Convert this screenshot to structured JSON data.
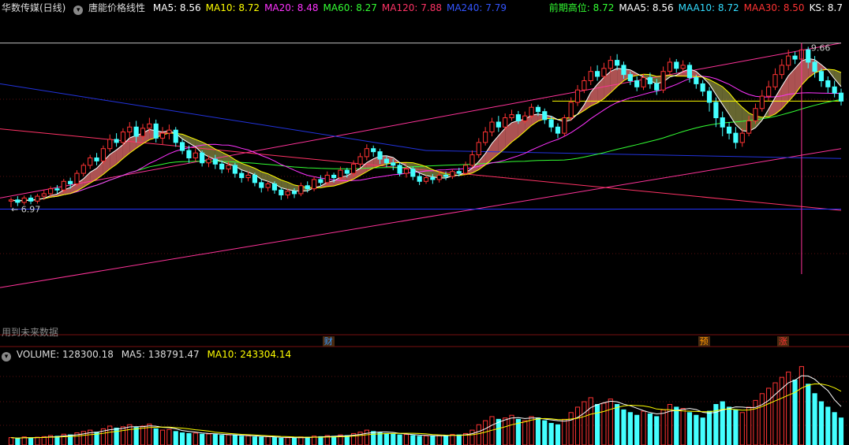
{
  "header": {
    "stock_name": "华数传媒(日线)",
    "indicator_name": "唐能价格线性",
    "ma": [
      {
        "label": "MA5:",
        "value": "8.56",
        "color": "#ffffff"
      },
      {
        "label": "MA10:",
        "value": "8.72",
        "color": "#ffff00"
      },
      {
        "label": "MA20:",
        "value": "8.48",
        "color": "#ff33ff"
      },
      {
        "label": "MA60:",
        "value": "8.27",
        "color": "#33ff33"
      },
      {
        "label": "MA120:",
        "value": "7.88",
        "color": "#ff3366"
      },
      {
        "label": "MA240:",
        "value": "7.79",
        "color": "#3355ff"
      }
    ],
    "right": [
      {
        "label": "前期高位:",
        "value": "8.72",
        "color": "#33ff33"
      },
      {
        "label": "MAA5:",
        "value": "8.56",
        "color": "#ffffff"
      },
      {
        "label": "MAA10:",
        "value": "8.72",
        "color": "#33ddff"
      },
      {
        "label": "MAA30:",
        "value": "8.50",
        "color": "#ff3333"
      },
      {
        "label": "KS:",
        "value": "8.7",
        "color": "#ffffff"
      }
    ]
  },
  "volume_header": {
    "volume_label": "VOLUME:",
    "volume_value": "128300.18",
    "ma5_label": "MA5:",
    "ma5_value": "138791.47",
    "ma10_label": "MA10:",
    "ma10_value": "243304.14"
  },
  "notes": {
    "future_data": "用到未来数据"
  },
  "events": [
    {
      "label": "财",
      "index": 48,
      "color": "#3399ff"
    },
    {
      "label": "预",
      "index": 105,
      "color": "#ff9900"
    },
    {
      "label": "涨",
      "index": 117,
      "color": "#ff3333"
    }
  ],
  "chart_data": {
    "type": "candlestick",
    "ylim": [
      5.0,
      10.0
    ],
    "price_high_label": "9.66",
    "price_low_label": "6.97",
    "previous_high_level": 8.72,
    "candles": [
      [
        7.1,
        7.12,
        7.0,
        7.16
      ],
      [
        7.12,
        7.08,
        7.02,
        7.18
      ],
      [
        7.08,
        7.15,
        7.04,
        7.19
      ],
      [
        7.15,
        7.1,
        7.05,
        7.2
      ],
      [
        7.1,
        7.18,
        7.06,
        7.22
      ],
      [
        7.18,
        7.22,
        7.12,
        7.28
      ],
      [
        7.22,
        7.3,
        7.18,
        7.34
      ],
      [
        7.3,
        7.28,
        7.22,
        7.36
      ],
      [
        7.28,
        7.42,
        7.24,
        7.46
      ],
      [
        7.42,
        7.38,
        7.3,
        7.48
      ],
      [
        7.38,
        7.55,
        7.34,
        7.6
      ],
      [
        7.55,
        7.68,
        7.5,
        7.72
      ],
      [
        7.68,
        7.8,
        7.62,
        7.85
      ],
      [
        7.8,
        7.75,
        7.68,
        7.88
      ],
      [
        7.75,
        7.95,
        7.7,
        8.0
      ],
      [
        7.95,
        8.1,
        7.9,
        8.18
      ],
      [
        8.1,
        8.05,
        7.98,
        8.2
      ],
      [
        8.05,
        8.22,
        8.0,
        8.28
      ],
      [
        8.22,
        8.3,
        8.12,
        8.38
      ],
      [
        8.3,
        8.15,
        8.05,
        8.4
      ],
      [
        8.15,
        8.28,
        8.08,
        8.35
      ],
      [
        8.28,
        8.35,
        8.2,
        8.45
      ],
      [
        8.35,
        8.12,
        8.05,
        8.42
      ],
      [
        8.12,
        8.2,
        8.02,
        8.3
      ],
      [
        8.2,
        8.25,
        8.1,
        8.34
      ],
      [
        8.25,
        8.05,
        7.98,
        8.3
      ],
      [
        8.05,
        7.92,
        7.86,
        8.1
      ],
      [
        7.92,
        7.8,
        7.72,
        8.0
      ],
      [
        7.8,
        7.88,
        7.74,
        7.95
      ],
      [
        7.88,
        7.72,
        7.66,
        7.92
      ],
      [
        7.72,
        7.78,
        7.65,
        7.84
      ],
      [
        7.78,
        7.7,
        7.62,
        7.85
      ],
      [
        7.7,
        7.62,
        7.55,
        7.76
      ],
      [
        7.62,
        7.68,
        7.56,
        7.74
      ],
      [
        7.68,
        7.55,
        7.48,
        7.72
      ],
      [
        7.55,
        7.48,
        7.4,
        7.6
      ],
      [
        7.48,
        7.52,
        7.42,
        7.58
      ],
      [
        7.52,
        7.4,
        7.34,
        7.56
      ],
      [
        7.4,
        7.32,
        7.24,
        7.45
      ],
      [
        7.32,
        7.38,
        7.26,
        7.42
      ],
      [
        7.38,
        7.28,
        7.22,
        7.42
      ],
      [
        7.28,
        7.2,
        7.12,
        7.32
      ],
      [
        7.2,
        7.26,
        7.14,
        7.3
      ],
      [
        7.26,
        7.22,
        7.15,
        7.31
      ],
      [
        7.22,
        7.35,
        7.18,
        7.4
      ],
      [
        7.35,
        7.3,
        7.24,
        7.42
      ],
      [
        7.3,
        7.45,
        7.26,
        7.5
      ],
      [
        7.45,
        7.4,
        7.34,
        7.52
      ],
      [
        7.4,
        7.52,
        7.36,
        7.58
      ],
      [
        7.52,
        7.48,
        7.4,
        7.56
      ],
      [
        7.48,
        7.6,
        7.44,
        7.66
      ],
      [
        7.6,
        7.55,
        7.48,
        7.64
      ],
      [
        7.55,
        7.7,
        7.5,
        7.76
      ],
      [
        7.7,
        7.82,
        7.64,
        7.88
      ],
      [
        7.82,
        7.95,
        7.76,
        8.02
      ],
      [
        7.95,
        7.9,
        7.82,
        8.0
      ],
      [
        7.9,
        7.78,
        7.7,
        7.95
      ],
      [
        7.78,
        7.72,
        7.65,
        7.84
      ],
      [
        7.72,
        7.68,
        7.6,
        7.78
      ],
      [
        7.68,
        7.55,
        7.5,
        7.72
      ],
      [
        7.55,
        7.62,
        7.48,
        7.68
      ],
      [
        7.62,
        7.5,
        7.44,
        7.66
      ],
      [
        7.5,
        7.42,
        7.36,
        7.55
      ],
      [
        7.42,
        7.48,
        7.38,
        7.52
      ],
      [
        7.48,
        7.45,
        7.38,
        7.54
      ],
      [
        7.45,
        7.52,
        7.4,
        7.58
      ],
      [
        7.52,
        7.5,
        7.44,
        7.58
      ],
      [
        7.5,
        7.58,
        7.46,
        7.62
      ],
      [
        7.58,
        7.55,
        7.5,
        7.64
      ],
      [
        7.55,
        7.68,
        7.52,
        7.74
      ],
      [
        7.68,
        7.85,
        7.64,
        7.92
      ],
      [
        7.85,
        8.05,
        7.8,
        8.12
      ],
      [
        8.05,
        8.22,
        8.0,
        8.3
      ],
      [
        8.22,
        8.38,
        8.15,
        8.45
      ],
      [
        8.38,
        8.3,
        8.22,
        8.48
      ],
      [
        8.3,
        8.45,
        8.25,
        8.52
      ],
      [
        8.45,
        8.5,
        8.4,
        8.58
      ],
      [
        8.5,
        8.4,
        8.35,
        8.56
      ],
      [
        8.4,
        8.48,
        8.36,
        8.55
      ],
      [
        8.48,
        8.62,
        8.44,
        8.68
      ],
      [
        8.62,
        8.55,
        8.48,
        8.66
      ],
      [
        8.55,
        8.42,
        8.35,
        8.6
      ],
      [
        8.42,
        8.3,
        8.22,
        8.48
      ],
      [
        8.3,
        8.2,
        8.12,
        8.36
      ],
      [
        8.2,
        8.45,
        8.15,
        8.5
      ],
      [
        8.45,
        8.7,
        8.4,
        8.78
      ],
      [
        8.7,
        8.9,
        8.64,
        8.98
      ],
      [
        8.9,
        9.05,
        8.85,
        9.12
      ],
      [
        9.05,
        9.2,
        8.98,
        9.28
      ],
      [
        9.2,
        9.12,
        9.05,
        9.3
      ],
      [
        9.12,
        9.25,
        9.08,
        9.34
      ],
      [
        9.25,
        9.38,
        9.18,
        9.45
      ],
      [
        9.38,
        9.3,
        9.22,
        9.48
      ],
      [
        9.3,
        9.15,
        9.08,
        9.36
      ],
      [
        9.15,
        9.05,
        8.98,
        9.2
      ],
      [
        9.05,
        8.95,
        8.88,
        9.12
      ],
      [
        8.95,
        9.1,
        8.9,
        9.16
      ],
      [
        9.1,
        9.0,
        8.92,
        9.18
      ],
      [
        9.0,
        8.9,
        8.82,
        9.08
      ],
      [
        8.9,
        9.2,
        8.85,
        9.28
      ],
      [
        9.2,
        9.35,
        9.15,
        9.42
      ],
      [
        9.35,
        9.25,
        9.18,
        9.4
      ],
      [
        9.25,
        9.3,
        9.2,
        9.38
      ],
      [
        9.3,
        9.1,
        9.02,
        9.35
      ],
      [
        9.1,
        9.0,
        8.92,
        9.15
      ],
      [
        9.0,
        8.88,
        8.8,
        9.06
      ],
      [
        8.88,
        8.7,
        8.55,
        8.95
      ],
      [
        8.7,
        8.45,
        8.3,
        8.78
      ],
      [
        8.45,
        8.3,
        8.15,
        8.55
      ],
      [
        8.3,
        8.2,
        8.1,
        8.38
      ],
      [
        8.2,
        8.05,
        7.95,
        8.3
      ],
      [
        8.05,
        8.2,
        7.98,
        8.28
      ],
      [
        8.2,
        8.4,
        8.15,
        8.48
      ],
      [
        8.4,
        8.6,
        8.35,
        8.68
      ],
      [
        8.6,
        8.8,
        8.55,
        8.9
      ],
      [
        8.8,
        8.95,
        8.72,
        9.05
      ],
      [
        8.95,
        9.15,
        8.9,
        9.25
      ],
      [
        9.15,
        9.3,
        9.08,
        9.4
      ],
      [
        9.3,
        9.45,
        9.22,
        9.55
      ],
      [
        9.45,
        9.4,
        9.32,
        9.52
      ],
      [
        9.4,
        9.55,
        9.35,
        9.66
      ],
      [
        9.55,
        9.35,
        9.25,
        9.6
      ],
      [
        9.35,
        9.2,
        9.1,
        9.45
      ],
      [
        9.2,
        9.05,
        8.95,
        9.25
      ],
      [
        9.05,
        8.95,
        8.85,
        9.12
      ],
      [
        8.95,
        8.85,
        8.78,
        9.05
      ],
      [
        8.85,
        8.72,
        8.65,
        8.92
      ]
    ],
    "volume": {
      "ylim": [
        0,
        600000
      ],
      "values": [
        55000,
        48000,
        60000,
        52000,
        58000,
        62000,
        70000,
        65000,
        80000,
        75000,
        90000,
        100000,
        110000,
        95000,
        120000,
        140000,
        125000,
        135000,
        150000,
        130000,
        140000,
        155000,
        120000,
        110000,
        115000,
        100000,
        90000,
        85000,
        88000,
        80000,
        82000,
        78000,
        72000,
        75000,
        70000,
        65000,
        68000,
        60000,
        58000,
        62000,
        55000,
        50000,
        54000,
        52000,
        60000,
        58000,
        66000,
        62000,
        70000,
        65000,
        75000,
        70000,
        85000,
        95000,
        110000,
        100000,
        90000,
        85000,
        80000,
        75000,
        78000,
        70000,
        65000,
        68000,
        66000,
        72000,
        70000,
        78000,
        75000,
        85000,
        110000,
        150000,
        180000,
        210000,
        190000,
        200000,
        220000,
        190000,
        180000,
        210000,
        200000,
        180000,
        160000,
        150000,
        190000,
        240000,
        280000,
        320000,
        350000,
        300000,
        310000,
        340000,
        300000,
        260000,
        240000,
        220000,
        250000,
        230000,
        210000,
        260000,
        300000,
        280000,
        270000,
        240000,
        220000,
        200000,
        250000,
        300000,
        320000,
        280000,
        260000,
        240000,
        280000,
        330000,
        380000,
        420000,
        460000,
        500000,
        540000,
        480000,
        580000,
        450000,
        380000,
        320000,
        280000,
        240000,
        200000
      ]
    }
  }
}
